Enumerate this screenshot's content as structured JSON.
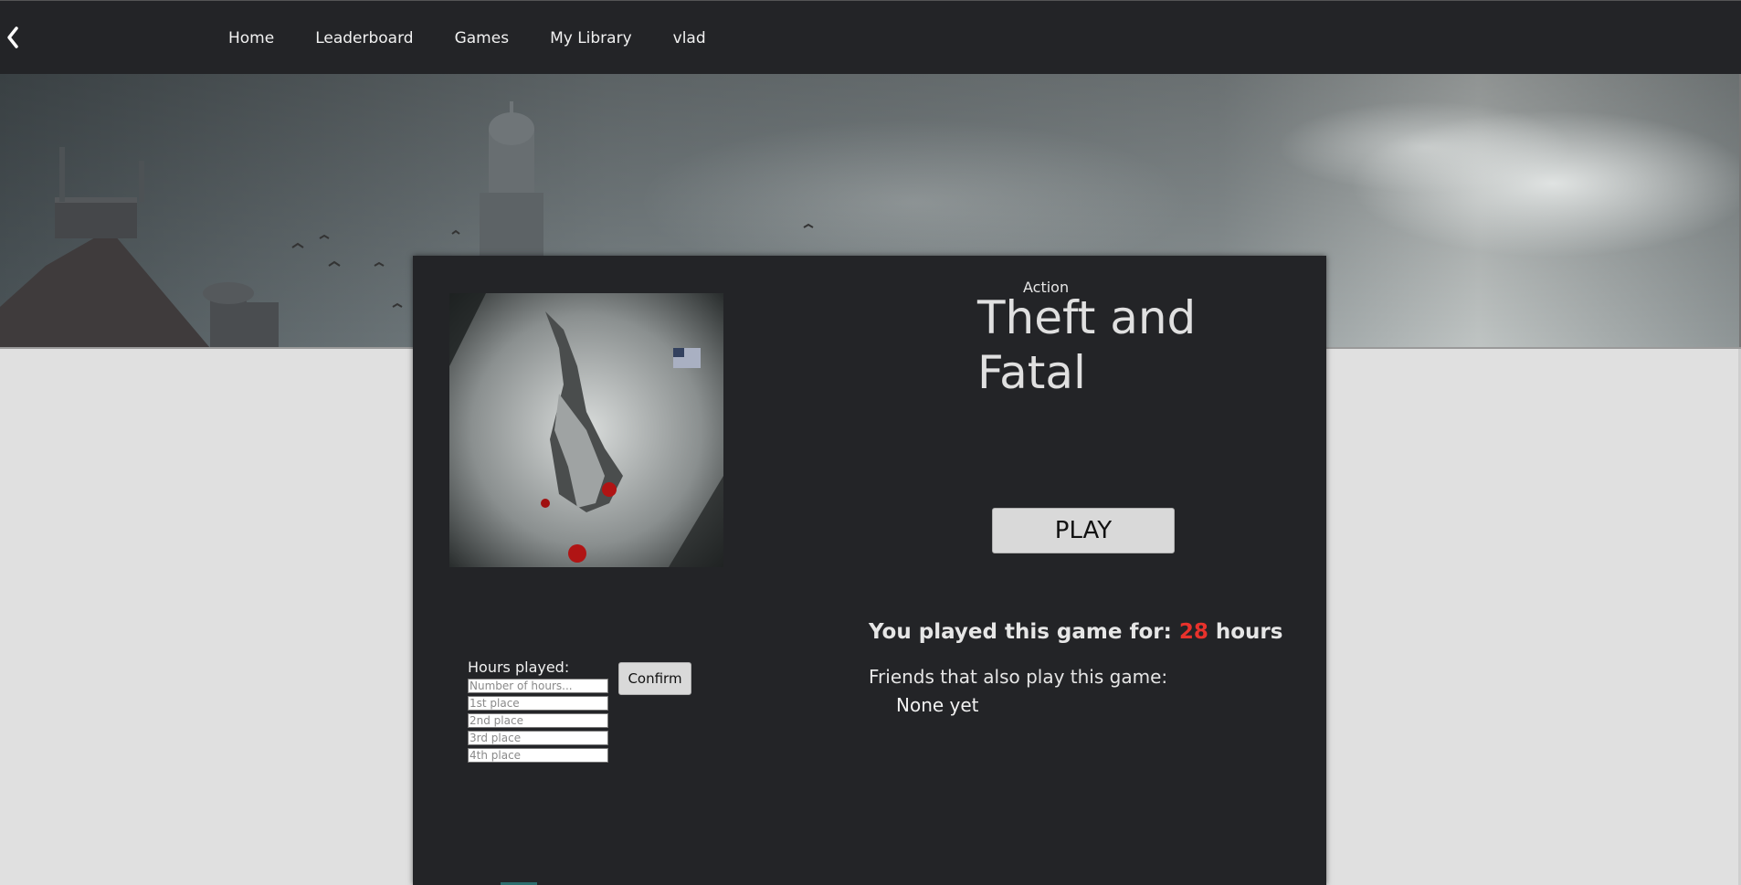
{
  "nav": {
    "back_icon": "chevron-left-icon",
    "items": [
      {
        "label": "Home"
      },
      {
        "label": "Leaderboard"
      },
      {
        "label": "Games"
      },
      {
        "label": "My Library"
      },
      {
        "label": "vlad"
      }
    ]
  },
  "game": {
    "genre": "Action",
    "title": "Theft and Fatal",
    "play_label": "PLAY",
    "played_prefix": "You played this game for:",
    "played_hours": "28",
    "played_suffix": "hours",
    "friends_label": "Friends that also play this game:",
    "friends_empty": "None yet"
  },
  "form": {
    "label": "Hours played:",
    "hours_placeholder": "Number of hours...",
    "place1_placeholder": "1st place",
    "place2_placeholder": "2nd place",
    "place3_placeholder": "3rd place",
    "place4_placeholder": "4th place",
    "confirm_label": "Confirm"
  },
  "colors": {
    "topbar": "#232427",
    "card": "#232427",
    "background": "#e0e0e0",
    "accent_hours": "#e8322c"
  }
}
